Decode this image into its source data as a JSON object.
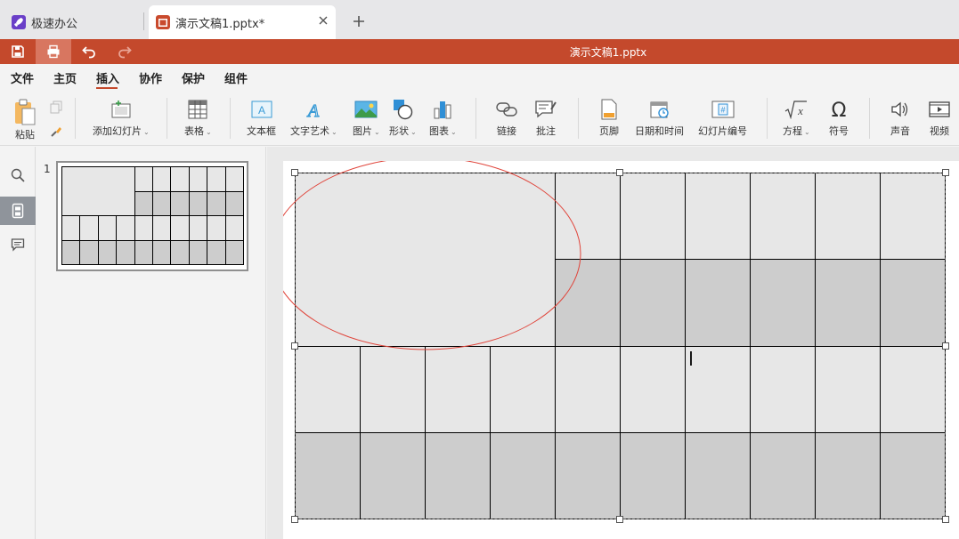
{
  "tabs": [
    {
      "label": "极速办公",
      "icon": "rocket-icon",
      "active": false
    },
    {
      "label": "演示文稿1.pptx*",
      "icon": "presentation-icon",
      "active": true
    }
  ],
  "titlebar": {
    "title": "演示文稿1.pptx"
  },
  "menu": [
    "文件",
    "主页",
    "插入",
    "协作",
    "保护",
    "组件"
  ],
  "menu_active": "插入",
  "ribbon": {
    "paste": "粘贴",
    "add_slide": "添加幻灯片",
    "table": "表格",
    "textbox": "文本框",
    "wordart": "文字艺术",
    "image": "图片",
    "shape": "形状",
    "chart": "图表",
    "link": "链接",
    "comment": "批注",
    "footer": "页脚",
    "datetime": "日期和时间",
    "slide_number": "幻灯片编号",
    "equation": "方程",
    "symbol": "符号",
    "audio": "声音",
    "video": "视频"
  },
  "thumbnail": {
    "number": "1"
  },
  "colors": {
    "accent": "#c4492c",
    "cell_light": "#e7e7e7",
    "cell_dark": "#cdcdcd",
    "ellipse": "#e0443a"
  }
}
